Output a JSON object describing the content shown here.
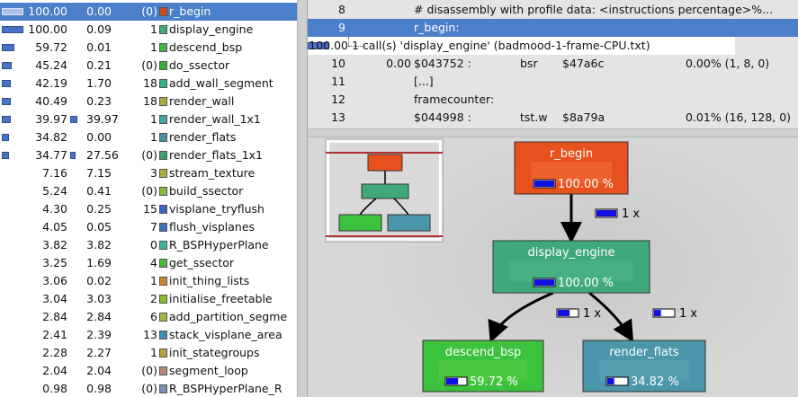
{
  "functions": [
    {
      "incl": "100.00",
      "self": "0.00",
      "calls": "(0)",
      "name": "r_begin",
      "color": "#d2491d",
      "bar": 100,
      "selfbar": 0,
      "selected": true
    },
    {
      "incl": "100.00",
      "self": "0.09",
      "calls": "1",
      "name": "display_engine",
      "color": "#3fa97a",
      "bar": 100,
      "selfbar": 0
    },
    {
      "incl": "59.72",
      "self": "0.01",
      "calls": "1",
      "name": "descend_bsp",
      "color": "#3cb83c",
      "bar": 59.72,
      "selfbar": 0
    },
    {
      "incl": "45.24",
      "self": "0.21",
      "calls": "(0)",
      "name": "do_ssector",
      "color": "#3bab3b",
      "bar": 45.24,
      "selfbar": 0
    },
    {
      "incl": "42.19",
      "self": "1.70",
      "calls": "18",
      "name": "add_wall_segment",
      "color": "#2fb38a",
      "bar": 42.19,
      "selfbar": 0
    },
    {
      "incl": "40.49",
      "self": "0.23",
      "calls": "18",
      "name": "render_wall",
      "color": "#a8ad3a",
      "bar": 40.49,
      "selfbar": 0
    },
    {
      "incl": "39.97",
      "self": "39.97",
      "calls": "1",
      "name": "render_wall_1x1",
      "color": "#3aa7a4",
      "bar": 39.97,
      "selfbar": 39.97
    },
    {
      "incl": "34.82",
      "self": "0.00",
      "calls": "1",
      "name": "render_flats",
      "color": "#4a8fa8",
      "bar": 34.82,
      "selfbar": 0
    },
    {
      "incl": "34.77",
      "self": "27.56",
      "calls": "(0)",
      "name": "render_flats_1x1",
      "color": "#3aa06f",
      "bar": 34.77,
      "selfbar": 27.56
    },
    {
      "incl": "7.16",
      "self": "7.15",
      "calls": "3",
      "name": "stream_texture",
      "color": "#aab23c",
      "bar": 0,
      "selfbar": 0
    },
    {
      "incl": "5.24",
      "self": "0.41",
      "calls": "(0)",
      "name": "build_ssector",
      "color": "#8fb838",
      "bar": 0,
      "selfbar": 0
    },
    {
      "incl": "4.30",
      "self": "0.25",
      "calls": "15",
      "name": "visplane_tryflush",
      "color": "#3a62c8",
      "bar": 0,
      "selfbar": 0
    },
    {
      "incl": "4.05",
      "self": "0.05",
      "calls": "7",
      "name": "flush_visplanes",
      "color": "#3e6fb8",
      "bar": 0,
      "selfbar": 0
    },
    {
      "incl": "3.82",
      "self": "3.82",
      "calls": "0",
      "name": "R_BSPHyperPlane",
      "color": "#3bb4a0",
      "bar": 0,
      "selfbar": 0
    },
    {
      "incl": "3.25",
      "self": "1.69",
      "calls": "4",
      "name": "get_ssector",
      "color": "#4ab83a",
      "bar": 0,
      "selfbar": 0
    },
    {
      "incl": "3.06",
      "self": "0.02",
      "calls": "1",
      "name": "init_thing_lists",
      "color": "#c9882e",
      "bar": 0,
      "selfbar": 0
    },
    {
      "incl": "3.04",
      "self": "3.03",
      "calls": "2",
      "name": "initialise_freetable",
      "color": "#8cbf2c",
      "bar": 0,
      "selfbar": 0
    },
    {
      "incl": "2.84",
      "self": "2.84",
      "calls": "6",
      "name": "add_partition_segme",
      "color": "#a6b43c",
      "bar": 0,
      "selfbar": 0
    },
    {
      "incl": "2.41",
      "self": "2.39",
      "calls": "13",
      "name": "stack_visplane_area",
      "color": "#3a8fb0",
      "bar": 0,
      "selfbar": 0
    },
    {
      "incl": "2.28",
      "self": "2.27",
      "calls": "1",
      "name": "init_stategroups",
      "color": "#b8a23a",
      "bar": 0,
      "selfbar": 0
    },
    {
      "incl": "2.04",
      "self": "2.04",
      "calls": "(0)",
      "name": "segment_loop",
      "color": "#b98a76",
      "bar": 0,
      "selfbar": 0
    },
    {
      "incl": "0.98",
      "self": "0.98",
      "calls": "(0)",
      "name": "R_BSPHyperPlane_R",
      "color": "#7a8fb2",
      "bar": 0,
      "selfbar": 0
    }
  ],
  "disasm": {
    "rows": [
      {
        "num": "8",
        "cost": "",
        "code": "# disassembly with profile data: <instructions percentage>%...",
        "op": "",
        "arg": "",
        "pct": ""
      },
      {
        "num": "9",
        "cost": "",
        "code": "r_begin:",
        "op": "",
        "arg": "",
        "pct": "",
        "selected": true
      },
      {
        "num": "10",
        "cost": "0.00",
        "code": "$043752 :",
        "op": "bsr",
        "arg": "$47a6c",
        "pct": "0.00% (1, 8, 0)"
      },
      {
        "num": "11",
        "cost": "",
        "code": "[...]",
        "op": "",
        "arg": "",
        "pct": ""
      },
      {
        "num": "12",
        "cost": "",
        "code": "framecounter:",
        "op": "",
        "arg": "",
        "pct": ""
      },
      {
        "num": "13",
        "cost": "",
        "code": "$044998 :",
        "op": "tst.w",
        "arg": "$8a79a",
        "pct": "0.01% (16, 128, 0)"
      }
    ],
    "call_row": {
      "cost": "100.00",
      "text": "1 call(s) 'display_engine' (badmood-1-frame-CPU.txt)"
    }
  },
  "graph": {
    "nodes": [
      {
        "id": "r_begin",
        "name": "r_begin",
        "pct": "100.00 %",
        "fill": "#e8501e",
        "inner": "#ee6a32",
        "barfrac": 1.0
      },
      {
        "id": "display_engine",
        "name": "display_engine",
        "pct": "100.00 %",
        "fill": "#3fa97a",
        "inner": "#4db587",
        "barfrac": 1.0
      },
      {
        "id": "descend_bsp",
        "name": "descend_bsp",
        "pct": "59.72 %",
        "fill": "#3cc23c",
        "inner": "#55cc45",
        "barfrac": 0.5972
      },
      {
        "id": "render_flats",
        "name": "render_flats",
        "pct": "34.82 %",
        "fill": "#4a96aa",
        "inner": "#58a2b4",
        "barfrac": 0.3482
      }
    ],
    "edges": [
      {
        "from": "r_begin",
        "to": "display_engine",
        "label": "1 x",
        "barfrac": 1.0
      },
      {
        "from": "display_engine",
        "to": "descend_bsp",
        "label": "1 x",
        "barfrac": 0.5972
      },
      {
        "from": "display_engine",
        "to": "render_flats",
        "label": "1 x",
        "barfrac": 0.3482
      }
    ]
  }
}
